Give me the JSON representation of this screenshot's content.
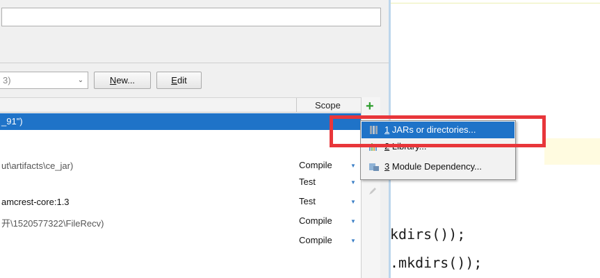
{
  "sdk_select": {
    "value": "3)"
  },
  "buttons": {
    "new_label": "New...",
    "new_mnemonic": "N",
    "edit_label": "Edit",
    "edit_mnemonic": "E"
  },
  "table": {
    "scope_header": "Scope",
    "rows": [
      {
        "name": "_91\")",
        "scope": "",
        "selected": true
      },
      {
        "name": "ut\\artifacts\\ce_jar)",
        "scope": "Compile"
      },
      {
        "name": "",
        "scope": "Test"
      },
      {
        "name": "amcrest-core:1.3",
        "scope": "Test"
      },
      {
        "name": "开\\1520577322\\FileRecv)",
        "scope": "Compile"
      },
      {
        "name": "",
        "scope": "Compile"
      }
    ]
  },
  "popup_menu": {
    "items": [
      {
        "number": "1",
        "label": "JARs or directories...",
        "icon": "jar-folder-icon"
      },
      {
        "number": "2",
        "label": "Library...",
        "icon": "library-icon"
      },
      {
        "number": "3",
        "label": "Module Dependency...",
        "icon": "module-icon"
      }
    ]
  },
  "editor": {
    "lines": [
      "kdirs());",
      ".mkdirs());"
    ]
  },
  "colors": {
    "selection": "#1f73c8",
    "add_icon": "#2f9e2f",
    "annotation_box": "#e8363a",
    "scope_arrow": "#3b7fc6"
  }
}
